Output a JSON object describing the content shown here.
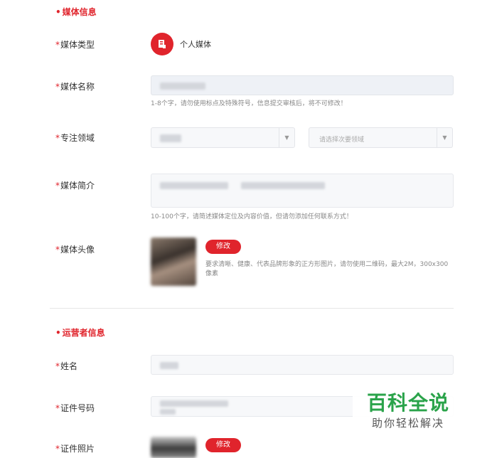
{
  "media_section": {
    "title": "媒体信息",
    "type_label": "媒体类型",
    "type_value": "个人媒体",
    "name_label": "媒体名称",
    "name_hint": "1-8个字，请勿使用标点及特殊符号，信息提交审核后，将不可修改！",
    "field_label": "专注领域",
    "secondary_placeholder": "请选择次要领域",
    "intro_label": "媒体简介",
    "intro_hint": "10-100个字，请简述媒体定位及内容价值，但请勿添加任何联系方式！",
    "avatar_label": "媒体头像",
    "avatar_button": "修改",
    "avatar_hint_line1": "要求清晰、健康、代表品牌形象的正方形图片，请勿使用二维码，最大2M，300x300",
    "avatar_hint_line2": "像素"
  },
  "operator_section": {
    "title": "运营者信息",
    "name_label": "姓名",
    "id_label": "证件号码",
    "photo_label": "证件照片",
    "photo_button": "修改"
  },
  "watermark": {
    "main": "百科全说",
    "sub": "助你轻松解决"
  },
  "colors": {
    "accent": "#e0242c",
    "watermark_green": "#2aa34a"
  }
}
